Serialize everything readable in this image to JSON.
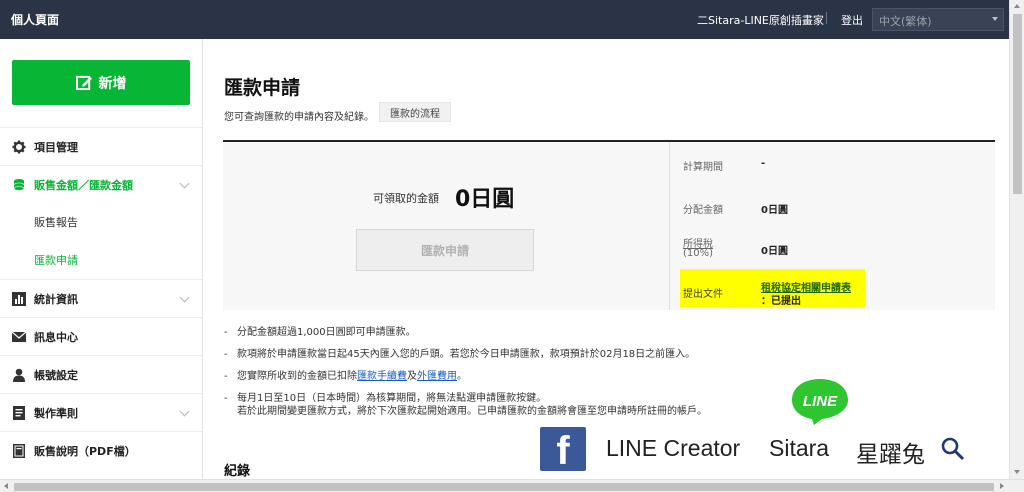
{
  "topbar": {
    "title": "個人頁面",
    "account": "二Sitara-LINE原創插畫家",
    "logout": "登出",
    "language": "中文(繁体)"
  },
  "sidebar": {
    "new_button": "新增",
    "items": [
      {
        "label": "項目管理",
        "icon": "gear-icon"
      },
      {
        "label": "販售金額／匯款金額",
        "icon": "coins-icon"
      },
      {
        "label": "販售報告"
      },
      {
        "label": "匯款申請"
      },
      {
        "label": "統計資訊",
        "icon": "bar-chart-icon"
      },
      {
        "label": "訊息中心",
        "icon": "envelope-icon"
      },
      {
        "label": "帳號設定",
        "icon": "user-icon"
      },
      {
        "label": "製作準則",
        "icon": "document-icon"
      },
      {
        "label": "販售說明（PDF檔）",
        "icon": "book-icon"
      }
    ]
  },
  "main": {
    "title": "匯款申請",
    "description": "您可查詢匯款的申請內容及紀錄。",
    "flow_button": "匯款的流程",
    "available_label": "可領取的金額",
    "available_value": "0日圓",
    "apply_button": "匯款申請",
    "info": {
      "period_label": "計算期間",
      "period_value": "-",
      "allocated_label": "分配金額",
      "allocated_value": "0日圓",
      "tax_label_1": "所得稅",
      "tax_label_2": "(10%)",
      "tax_value": "0日圓",
      "doc_label": "提出文件",
      "doc_link": "租稅協定相關申請表",
      "doc_status": "：已提出"
    },
    "notes": {
      "n1": "分配金額超過1,000日圓即可申請匯款。",
      "n2": "款項將於申請匯款當日起45天內匯入您的戶頭。若您於今日申請匯款，款項預計於02月18日之前匯入。",
      "n3_a": "您實際所收到的金額已扣除",
      "n3_link1": "匯款手續費",
      "n3_b": "及",
      "n3_link2": "外匯費用",
      "n3_c": "。",
      "n4_1": "每月1日至10日（日本時間）為核算期間，將無法點選申請匯款按鍵。",
      "n4_2": "若於此期間變更匯款方式，將於下次匯款起開始適用。已申請匯款的金額將會匯至您申請時所註冊的帳戶。"
    },
    "records_title": "紀錄"
  },
  "branding": {
    "facebook_letter": "f",
    "line_bubble": "LINE",
    "creator": "LINE Creator",
    "name": "Sitara",
    "name_cn": "星躍兔"
  },
  "colors": {
    "topbar": "#2b3446",
    "accent_green": "#06b634",
    "highlight": "#ffff00",
    "link_blue": "#1a5fc7",
    "facebook": "#3b5998"
  }
}
